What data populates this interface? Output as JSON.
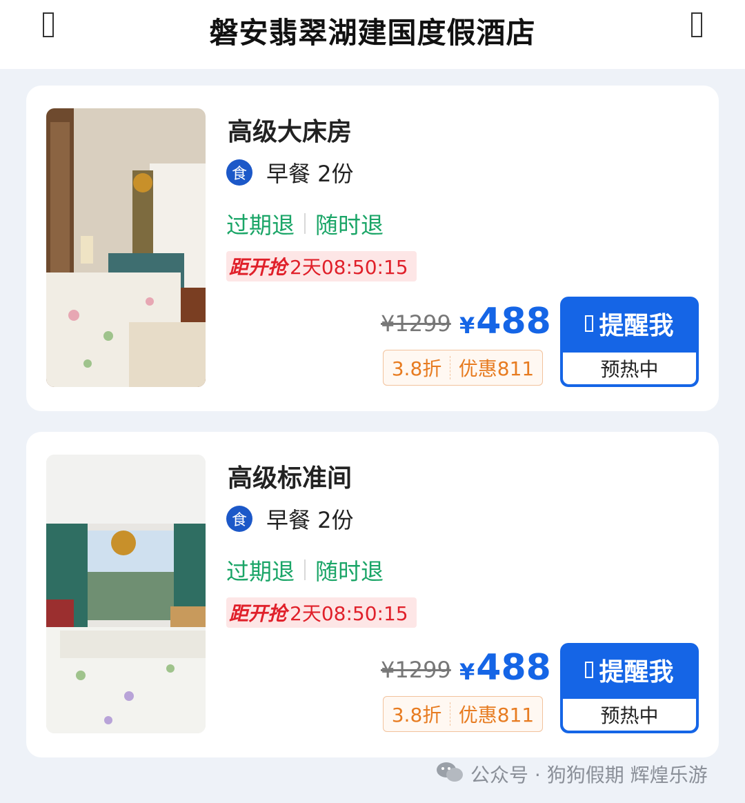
{
  "header": {
    "title": "磐安翡翠湖建国度假酒店",
    "left_icon": "back-icon",
    "right_icon": "share-icon"
  },
  "rooms": [
    {
      "name": "高级大床房",
      "meal_badge": "食",
      "meal": "早餐 2份",
      "policy_1": "过期退",
      "policy_2": "随时退",
      "countdown_label": "距开抢",
      "countdown_value": "2天08:50:15",
      "original_price": "¥1299",
      "currency": "¥",
      "price": "488",
      "discount": "3.8折",
      "savings": "优惠811",
      "remind_label": "提醒我",
      "remind_status": "预热中"
    },
    {
      "name": "高级标准间",
      "meal_badge": "食",
      "meal": "早餐 2份",
      "policy_1": "过期退",
      "policy_2": "随时退",
      "countdown_label": "距开抢",
      "countdown_value": "2天08:50:15",
      "original_price": "¥1299",
      "currency": "¥",
      "price": "488",
      "discount": "3.8折",
      "savings": "优惠811",
      "remind_label": "提醒我",
      "remind_status": "预热中"
    }
  ],
  "watermark": {
    "text": "公众号 · 狗狗假期 辉煌乐游"
  },
  "colors": {
    "accent_blue": "#1565e6",
    "policy_green": "#1aa567",
    "countdown_red": "#e0202a",
    "discount_orange": "#e77b20"
  }
}
